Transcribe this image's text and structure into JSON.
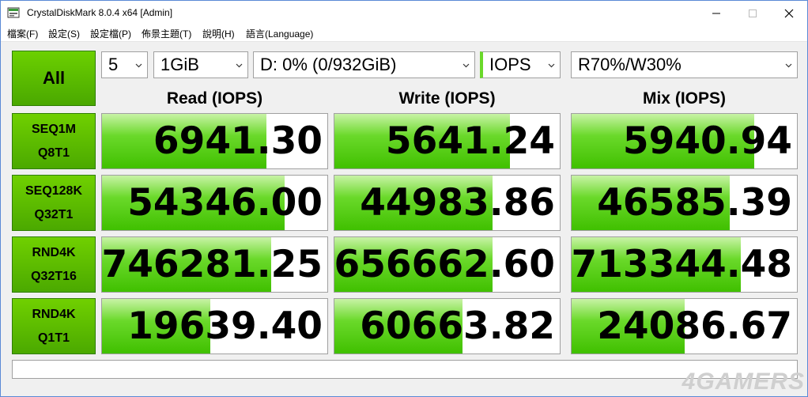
{
  "window": {
    "title": "CrystalDiskMark 8.0.4 x64 [Admin]"
  },
  "menu": [
    "檔案(F)",
    "設定(S)",
    "設定檔(P)",
    "佈景主題(T)",
    "說明(H)",
    "語言(Language)"
  ],
  "controls": {
    "all_label": "All",
    "count": "5",
    "size": "1GiB",
    "drive": "D: 0% (0/932GiB)",
    "unit": "IOPS",
    "mix": "R70%/W30%"
  },
  "headers": {
    "read": "Read (IOPS)",
    "write": "Write (IOPS)",
    "mix": "Mix (IOPS)"
  },
  "colors": {
    "accent": "#4aa800"
  },
  "rows": [
    {
      "line1": "SEQ1M",
      "line2": "Q8T1",
      "read": "6941.30",
      "write": "5641.24",
      "mix": "5940.94",
      "fill": {
        "read": 0.73,
        "write": 0.78,
        "mix": 0.81
      }
    },
    {
      "line1": "SEQ128K",
      "line2": "Q32T1",
      "read": "54346.00",
      "write": "44983.86",
      "mix": "46585.39",
      "fill": {
        "read": 0.81,
        "write": 0.7,
        "mix": 0.7
      }
    },
    {
      "line1": "RND4K",
      "line2": "Q32T16",
      "read": "746281.25",
      "write": "656662.60",
      "mix": "713344.48",
      "fill": {
        "read": 0.75,
        "write": 0.7,
        "mix": 0.75
      }
    },
    {
      "line1": "RND4K",
      "line2": "Q1T1",
      "read": "19639.40",
      "write": "60663.82",
      "mix": "24086.67",
      "fill": {
        "read": 0.48,
        "write": 0.57,
        "mix": 0.5
      }
    }
  ],
  "watermark": "4GAMERS"
}
